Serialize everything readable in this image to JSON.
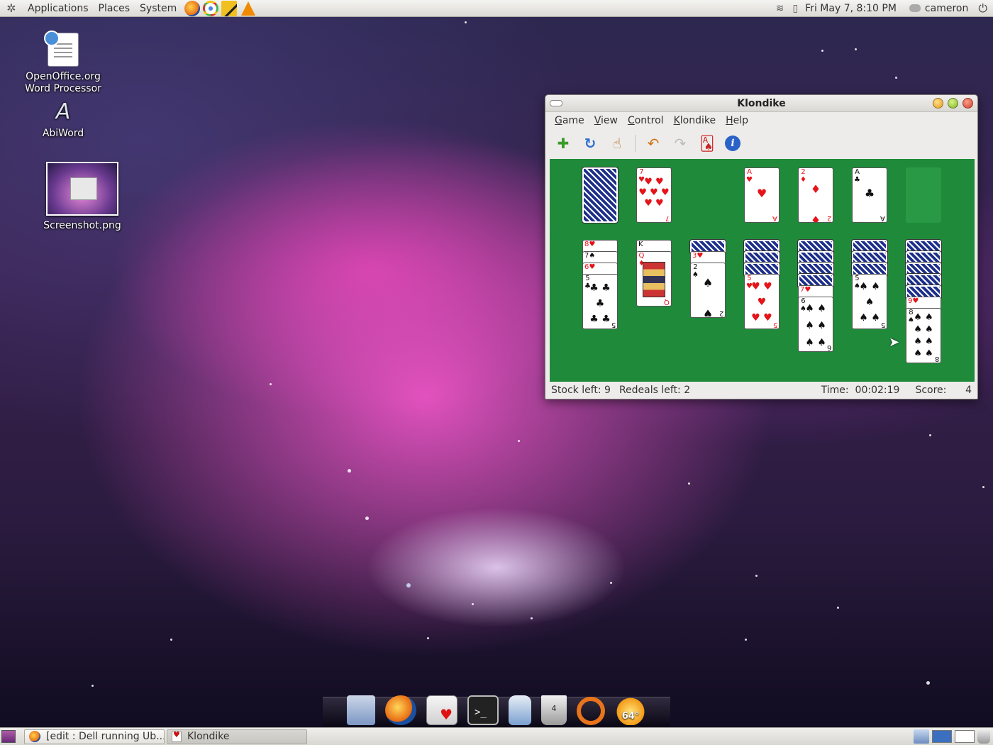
{
  "top_panel": {
    "menus": [
      "Applications",
      "Places",
      "System"
    ],
    "clock": "Fri May  7,  8:10 PM",
    "user": "cameron"
  },
  "desktop_icons": [
    {
      "label_line1": "OpenOffice.org",
      "label_line2": "Word Processor"
    },
    {
      "label_line1": "AbiWord"
    },
    {
      "label_line1": "Screenshot.png"
    }
  ],
  "window": {
    "title": "Klondike",
    "menu": [
      "Game",
      "View",
      "Control",
      "Klondike",
      "Help"
    ],
    "toolbar_icons": [
      "new-game-icon",
      "restart-icon",
      "hint-icon",
      "undo-icon",
      "redo-icon",
      "deal-icon",
      "info-icon"
    ],
    "status": {
      "stock": "Stock left: 9",
      "redeals": "Redeals left: 2",
      "time_label": "Time:",
      "time_value": "00:02:19",
      "score_label": "Score:",
      "score_value": "4"
    }
  },
  "board": {
    "waste": {
      "rank": "7",
      "suit": "♥"
    },
    "foundations": [
      {
        "rank": "A",
        "suit": "♥"
      },
      {
        "rank": "2",
        "suit": "♦"
      },
      {
        "rank": "A",
        "suit": "♣"
      }
    ],
    "tableau_faces": {
      "c1": [
        {
          "rank": "8",
          "suit": "♥"
        },
        {
          "rank": "7",
          "suit": "♠"
        },
        {
          "rank": "6",
          "suit": "♥"
        },
        {
          "rank": "5",
          "suit": "♣"
        }
      ],
      "c2": [
        {
          "rank": "K",
          "suit": "♦"
        },
        {
          "rank": "Q",
          "suit": "♦"
        }
      ],
      "c3": [
        {
          "rank": "3",
          "suit": "♥"
        },
        {
          "rank": "2",
          "suit": "♠"
        }
      ],
      "c4": [
        {
          "rank": "5",
          "suit": "♥"
        }
      ],
      "c5": [
        {
          "rank": "7",
          "suit": "♥"
        },
        {
          "rank": "6",
          "suit": "♠"
        }
      ],
      "c6": [
        {
          "rank": "5",
          "suit": "♠"
        }
      ],
      "c7": [
        {
          "rank": "9",
          "suit": "♥"
        },
        {
          "rank": "8",
          "suit": "♠"
        }
      ]
    }
  },
  "dock": {
    "trash_count": "4",
    "weather": "64°"
  },
  "taskbar": {
    "tasks": [
      "[edit : Dell running Ub...",
      "Klondike"
    ]
  }
}
